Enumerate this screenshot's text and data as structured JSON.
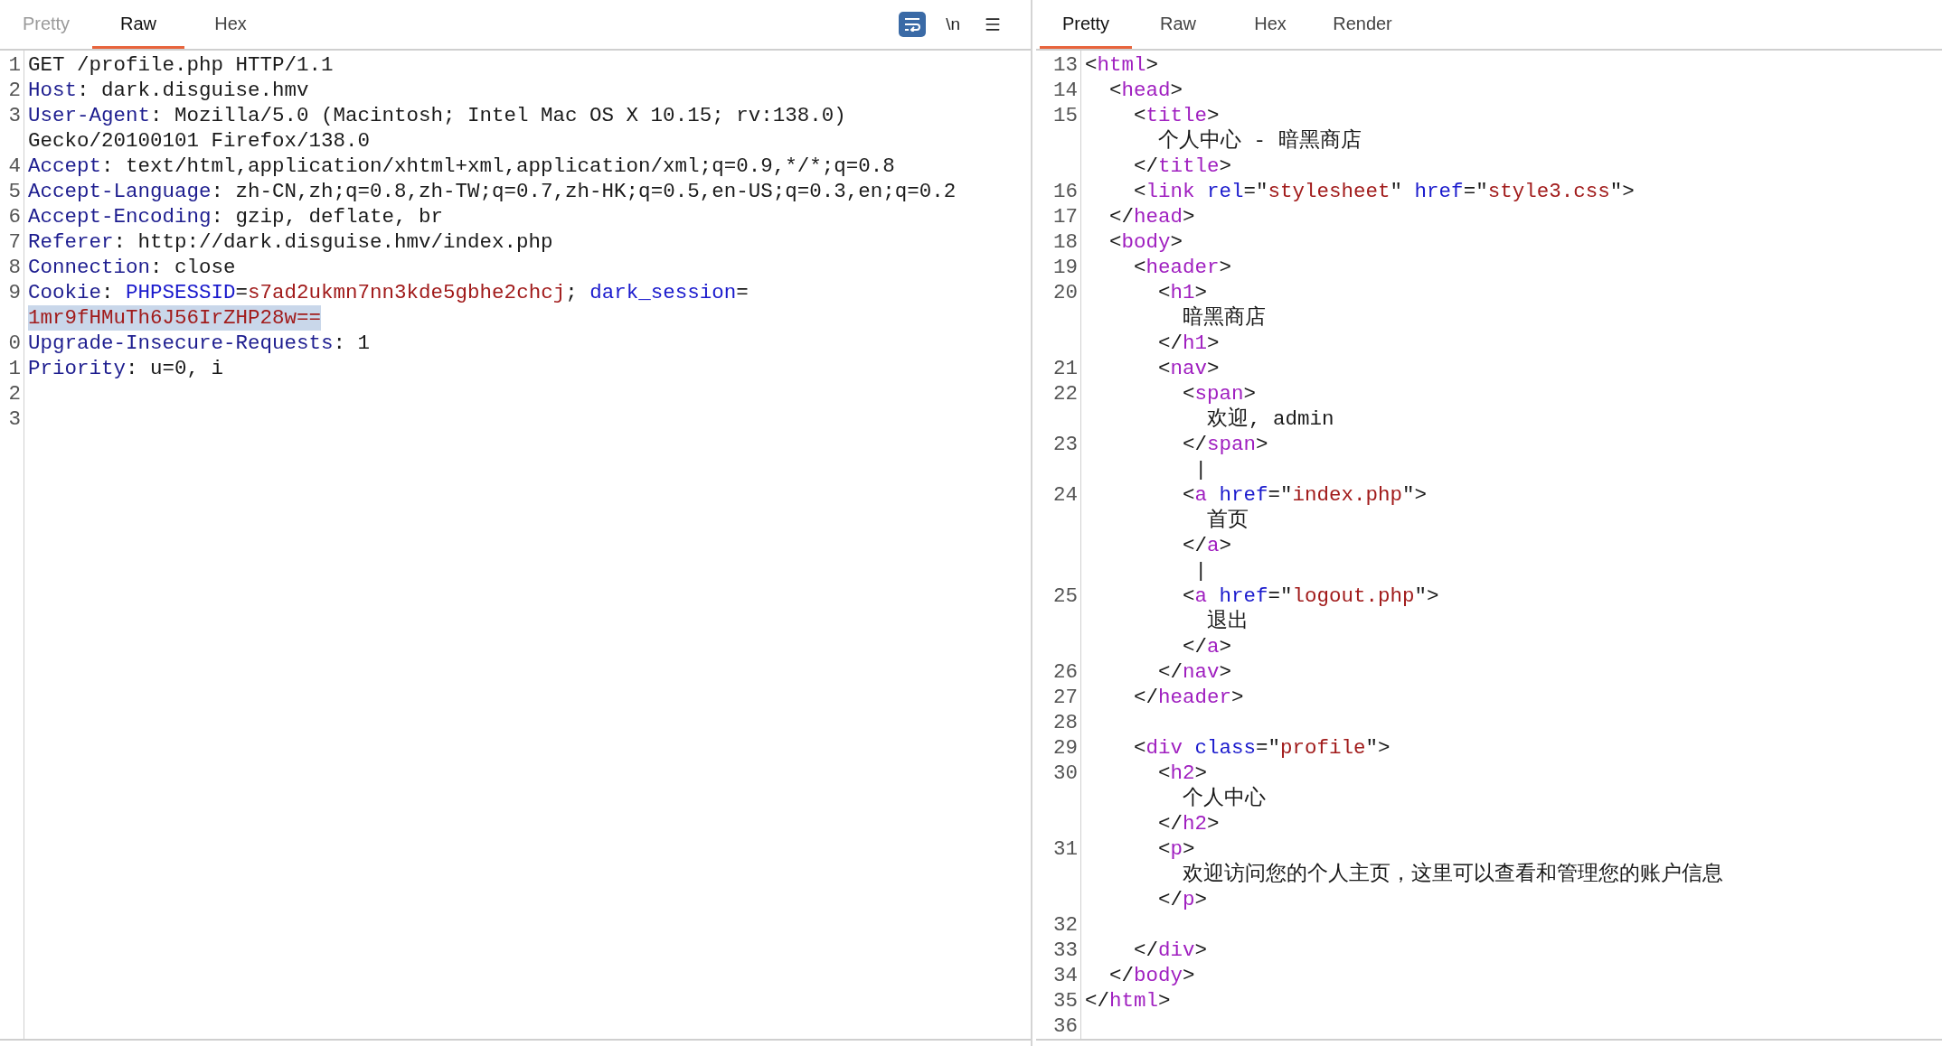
{
  "request": {
    "tabs": [
      {
        "label": "Pretty",
        "selected": false,
        "disabled": true
      },
      {
        "label": "Raw",
        "selected": true,
        "disabled": false
      },
      {
        "label": "Hex",
        "selected": false,
        "disabled": false
      }
    ],
    "toolbar": [
      {
        "kind": "wrap",
        "on": true
      },
      {
        "kind": "text",
        "label": "\\n",
        "on": false
      },
      {
        "kind": "menu"
      }
    ],
    "rows": [
      {
        "number": "1",
        "tokens": [
          {
            "t": "GET /profile.php HTTP/1.1",
            "kind": "plain"
          }
        ]
      },
      {
        "number": "2",
        "tokens": [
          {
            "t": "Host",
            "kind": "header"
          },
          {
            "t": ": dark.disguise.hmv",
            "kind": "plain"
          }
        ]
      },
      {
        "number": "3",
        "tokens": [
          {
            "t": "User-Agent",
            "kind": "header"
          },
          {
            "t": ": Mozilla/5.0 (Macintosh; Intel Mac OS X 10.15; rv:138.0)",
            "kind": "plain"
          }
        ]
      },
      {
        "tokens": [
          {
            "t": "Gecko/20100101 Firefox/138.0",
            "kind": "plain"
          }
        ]
      },
      {
        "number": "4",
        "tokens": [
          {
            "t": "Accept",
            "kind": "header"
          },
          {
            "t": ": text/html,application/xhtml+xml,application/xml;q=0.9,*/*;q=0.8",
            "kind": "plain"
          }
        ]
      },
      {
        "number": "5",
        "tokens": [
          {
            "t": "Accept-Language",
            "kind": "header"
          },
          {
            "t": ": zh-CN,zh;q=0.8,zh-TW;q=0.7,zh-HK;q=0.5,en-US;q=0.3,en;q=0.2",
            "kind": "plain"
          }
        ]
      },
      {
        "number": "6",
        "tokens": [
          {
            "t": "Accept-Encoding",
            "kind": "header"
          },
          {
            "t": ": gzip, deflate, br",
            "kind": "plain"
          }
        ]
      },
      {
        "number": "7",
        "tokens": [
          {
            "t": "Referer",
            "kind": "header"
          },
          {
            "t": ": http://dark.disguise.hmv/index.php",
            "kind": "plain"
          }
        ]
      },
      {
        "number": "8",
        "tokens": [
          {
            "t": "Connection",
            "kind": "header"
          },
          {
            "t": ": close",
            "kind": "plain"
          }
        ]
      },
      {
        "number": "9",
        "tokens": [
          {
            "t": "Cookie",
            "kind": "header"
          },
          {
            "t": ": ",
            "kind": "plain"
          },
          {
            "t": "PHPSESSID",
            "kind": "name"
          },
          {
            "t": "=",
            "kind": "plain"
          },
          {
            "t": "s7ad2ukmn7nn3kde5gbhe2chcj",
            "kind": "value"
          },
          {
            "t": "; ",
            "kind": "plain"
          },
          {
            "t": "dark_session",
            "kind": "name"
          },
          {
            "t": "=",
            "kind": "plain"
          }
        ]
      },
      {
        "tokens": [
          {
            "t": "1mr9fHMuTh6J56IrZHP28w==",
            "kind": "selected-value"
          }
        ]
      },
      {
        "number": "0",
        "tokens": [
          {
            "t": "Upgrade-Insecure-Requests",
            "kind": "header"
          },
          {
            "t": ": 1",
            "kind": "plain"
          }
        ]
      },
      {
        "number": "1",
        "tokens": [
          {
            "t": "Priority",
            "kind": "header"
          },
          {
            "t": ": u=0, i",
            "kind": "plain"
          }
        ]
      },
      {
        "number": "2",
        "tokens": []
      },
      {
        "number": "3",
        "tokens": []
      }
    ]
  },
  "response": {
    "tabs": [
      {
        "label": "Pretty",
        "selected": true,
        "disabled": false
      },
      {
        "label": "Raw",
        "selected": false,
        "disabled": false
      },
      {
        "label": "Hex",
        "selected": false,
        "disabled": false
      },
      {
        "label": "Render",
        "selected": false,
        "disabled": false
      }
    ],
    "rows": [
      {
        "number": "13",
        "tokens": [
          {
            "t": "<",
            "kind": "plain"
          },
          {
            "t": "html",
            "kind": "tag"
          },
          {
            "t": ">",
            "kind": "plain"
          }
        ]
      },
      {
        "number": "14",
        "tokens": [
          {
            "t": "  <",
            "kind": "plain"
          },
          {
            "t": "head",
            "kind": "tag"
          },
          {
            "t": ">",
            "kind": "plain"
          }
        ]
      },
      {
        "number": "15",
        "tokens": [
          {
            "t": "    <",
            "kind": "plain"
          },
          {
            "t": "title",
            "kind": "tag"
          },
          {
            "t": ">",
            "kind": "plain"
          }
        ]
      },
      {
        "tokens": [
          {
            "t": "      个人中心 - 暗黑商店",
            "kind": "plain"
          }
        ]
      },
      {
        "tokens": [
          {
            "t": "    </",
            "kind": "plain"
          },
          {
            "t": "title",
            "kind": "tag"
          },
          {
            "t": ">",
            "kind": "plain"
          }
        ]
      },
      {
        "number": "16",
        "tokens": [
          {
            "t": "    <",
            "kind": "plain"
          },
          {
            "t": "link",
            "kind": "tag"
          },
          {
            "t": " rel",
            "kind": "name"
          },
          {
            "t": "=\"",
            "kind": "plain"
          },
          {
            "t": "stylesheet",
            "kind": "value"
          },
          {
            "t": "\"",
            "kind": "plain"
          },
          {
            "t": " href",
            "kind": "name"
          },
          {
            "t": "=\"",
            "kind": "plain"
          },
          {
            "t": "style3.css",
            "kind": "value"
          },
          {
            "t": "\">",
            "kind": "plain"
          }
        ]
      },
      {
        "number": "17",
        "tokens": [
          {
            "t": "  </",
            "kind": "plain"
          },
          {
            "t": "head",
            "kind": "tag"
          },
          {
            "t": ">",
            "kind": "plain"
          }
        ]
      },
      {
        "number": "18",
        "tokens": [
          {
            "t": "  <",
            "kind": "plain"
          },
          {
            "t": "body",
            "kind": "tag"
          },
          {
            "t": ">",
            "kind": "plain"
          }
        ]
      },
      {
        "number": "19",
        "tokens": [
          {
            "t": "    <",
            "kind": "plain"
          },
          {
            "t": "header",
            "kind": "tag"
          },
          {
            "t": ">",
            "kind": "plain"
          }
        ]
      },
      {
        "number": "20",
        "tokens": [
          {
            "t": "      <",
            "kind": "plain"
          },
          {
            "t": "h1",
            "kind": "tag"
          },
          {
            "t": ">",
            "kind": "plain"
          }
        ]
      },
      {
        "tokens": [
          {
            "t": "        暗黑商店",
            "kind": "plain"
          }
        ]
      },
      {
        "tokens": [
          {
            "t": "      </",
            "kind": "plain"
          },
          {
            "t": "h1",
            "kind": "tag"
          },
          {
            "t": ">",
            "kind": "plain"
          }
        ]
      },
      {
        "number": "21",
        "tokens": [
          {
            "t": "      <",
            "kind": "plain"
          },
          {
            "t": "nav",
            "kind": "tag"
          },
          {
            "t": ">",
            "kind": "plain"
          }
        ]
      },
      {
        "number": "22",
        "tokens": [
          {
            "t": "        <",
            "kind": "plain"
          },
          {
            "t": "span",
            "kind": "tag"
          },
          {
            "t": ">",
            "kind": "plain"
          }
        ]
      },
      {
        "tokens": [
          {
            "t": "          欢迎, admin",
            "kind": "plain"
          }
        ]
      },
      {
        "number": "23",
        "tokens": [
          {
            "t": "        </",
            "kind": "plain"
          },
          {
            "t": "span",
            "kind": "tag"
          },
          {
            "t": ">",
            "kind": "plain"
          }
        ]
      },
      {
        "tokens": [
          {
            "t": "         |",
            "kind": "plain"
          }
        ]
      },
      {
        "number": "24",
        "tokens": [
          {
            "t": "        <",
            "kind": "plain"
          },
          {
            "t": "a",
            "kind": "tag"
          },
          {
            "t": " href",
            "kind": "name"
          },
          {
            "t": "=\"",
            "kind": "plain"
          },
          {
            "t": "index.php",
            "kind": "value"
          },
          {
            "t": "\">",
            "kind": "plain"
          }
        ]
      },
      {
        "tokens": [
          {
            "t": "          首页",
            "kind": "plain"
          }
        ]
      },
      {
        "tokens": [
          {
            "t": "        </",
            "kind": "plain"
          },
          {
            "t": "a",
            "kind": "tag"
          },
          {
            "t": ">",
            "kind": "plain"
          }
        ]
      },
      {
        "tokens": [
          {
            "t": "         |",
            "kind": "plain"
          }
        ]
      },
      {
        "number": "25",
        "tokens": [
          {
            "t": "        <",
            "kind": "plain"
          },
          {
            "t": "a",
            "kind": "tag"
          },
          {
            "t": " href",
            "kind": "name"
          },
          {
            "t": "=\"",
            "kind": "plain"
          },
          {
            "t": "logout.php",
            "kind": "value"
          },
          {
            "t": "\">",
            "kind": "plain"
          }
        ]
      },
      {
        "tokens": [
          {
            "t": "          退出",
            "kind": "plain"
          }
        ]
      },
      {
        "tokens": [
          {
            "t": "        </",
            "kind": "plain"
          },
          {
            "t": "a",
            "kind": "tag"
          },
          {
            "t": ">",
            "kind": "plain"
          }
        ]
      },
      {
        "number": "26",
        "tokens": [
          {
            "t": "      </",
            "kind": "plain"
          },
          {
            "t": "nav",
            "kind": "tag"
          },
          {
            "t": ">",
            "kind": "plain"
          }
        ]
      },
      {
        "number": "27",
        "tokens": [
          {
            "t": "    </",
            "kind": "plain"
          },
          {
            "t": "header",
            "kind": "tag"
          },
          {
            "t": ">",
            "kind": "plain"
          }
        ]
      },
      {
        "number": "28",
        "tokens": []
      },
      {
        "number": "29",
        "tokens": [
          {
            "t": "    <",
            "kind": "plain"
          },
          {
            "t": "div",
            "kind": "tag"
          },
          {
            "t": " class",
            "kind": "name"
          },
          {
            "t": "=\"",
            "kind": "plain"
          },
          {
            "t": "profile",
            "kind": "value"
          },
          {
            "t": "\">",
            "kind": "plain"
          }
        ]
      },
      {
        "number": "30",
        "tokens": [
          {
            "t": "      <",
            "kind": "plain"
          },
          {
            "t": "h2",
            "kind": "tag"
          },
          {
            "t": ">",
            "kind": "plain"
          }
        ]
      },
      {
        "tokens": [
          {
            "t": "        个人中心",
            "kind": "plain"
          }
        ]
      },
      {
        "tokens": [
          {
            "t": "      </",
            "kind": "plain"
          },
          {
            "t": "h2",
            "kind": "tag"
          },
          {
            "t": ">",
            "kind": "plain"
          }
        ]
      },
      {
        "number": "31",
        "tokens": [
          {
            "t": "      <",
            "kind": "plain"
          },
          {
            "t": "p",
            "kind": "tag"
          },
          {
            "t": ">",
            "kind": "plain"
          }
        ]
      },
      {
        "tokens": [
          {
            "t": "        欢迎访问您的个人主页，这里可以查看和管理您的账户信息",
            "kind": "plain"
          }
        ]
      },
      {
        "tokens": [
          {
            "t": "      </",
            "kind": "plain"
          },
          {
            "t": "p",
            "kind": "tag"
          },
          {
            "t": ">",
            "kind": "plain"
          }
        ]
      },
      {
        "number": "32",
        "tokens": []
      },
      {
        "number": "33",
        "tokens": [
          {
            "t": "    </",
            "kind": "plain"
          },
          {
            "t": "div",
            "kind": "tag"
          },
          {
            "t": ">",
            "kind": "plain"
          }
        ]
      },
      {
        "number": "34",
        "tokens": [
          {
            "t": "  </",
            "kind": "plain"
          },
          {
            "t": "body",
            "kind": "tag"
          },
          {
            "t": ">",
            "kind": "plain"
          }
        ]
      },
      {
        "number": "35",
        "tokens": [
          {
            "t": "</",
            "kind": "plain"
          },
          {
            "t": "html",
            "kind": "tag"
          },
          {
            "t": ">",
            "kind": "plain"
          }
        ]
      },
      {
        "number": "36",
        "tokens": []
      }
    ]
  }
}
